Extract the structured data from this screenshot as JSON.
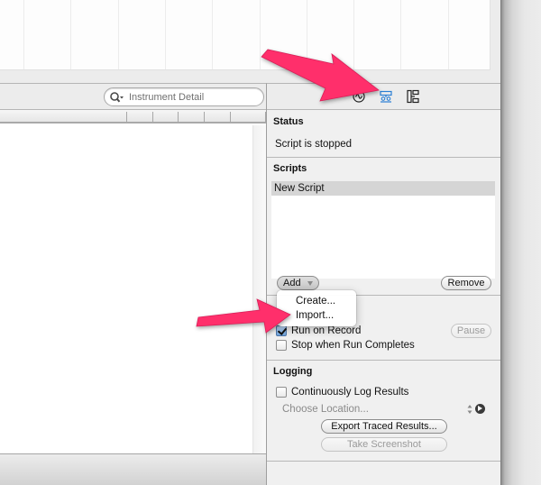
{
  "search": {
    "placeholder": "Instrument Detail"
  },
  "inspector": {
    "tabs": [
      {
        "name": "record-settings",
        "icon": "waveform-circle-icon",
        "active": false
      },
      {
        "name": "info-settings",
        "icon": "script-options-icon",
        "active": true
      },
      {
        "name": "extended-detail",
        "icon": "tree-layout-icon",
        "active": false
      }
    ],
    "status": {
      "title": "Status",
      "text": "Script is stopped"
    },
    "scripts": {
      "title": "Scripts",
      "items": [
        "New Script"
      ],
      "add_label": "Add",
      "remove_label": "Remove"
    },
    "playback": {
      "run_on_record_label": "Run on Record",
      "run_on_record_checked": true,
      "stop_when_complete_label": "Stop when Run Completes",
      "stop_when_complete_checked": false,
      "pause_label": "Pause"
    },
    "logging": {
      "title": "Logging",
      "continuous_log_label": "Continuously Log Results",
      "continuous_log_checked": false,
      "choose_location_label": "Choose Location...",
      "export_label": "Export Traced Results...",
      "screenshot_label": "Take Screenshot"
    }
  },
  "add_menu": {
    "items": [
      "Create...",
      "Import..."
    ]
  },
  "colors": {
    "annotation_arrow": "#ff2f6b",
    "active_tab": "#2a7fd4"
  }
}
